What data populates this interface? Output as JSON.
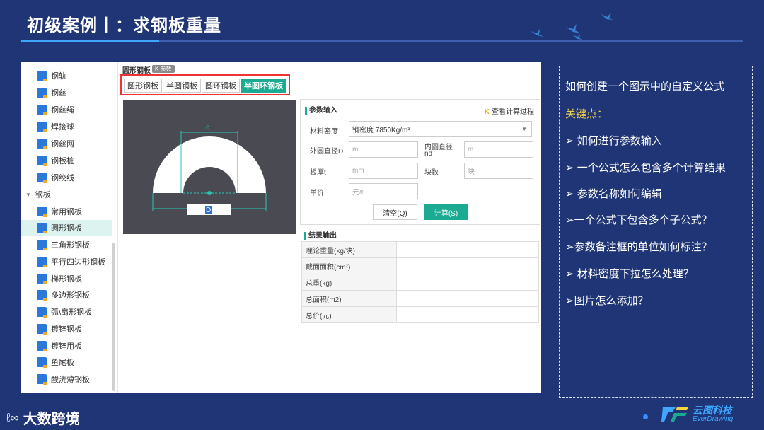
{
  "slide": {
    "title": "初级案例丨：求钢板重量"
  },
  "sidebar": {
    "items_top": [
      {
        "label": "钢轨"
      },
      {
        "label": "钢丝"
      },
      {
        "label": "钢丝绳"
      },
      {
        "label": "焊接球"
      },
      {
        "label": "钢丝网"
      },
      {
        "label": "钢板桩"
      },
      {
        "label": "钢绞线"
      }
    ],
    "group": {
      "label": "钢板"
    },
    "items": [
      {
        "label": "常用钢板"
      },
      {
        "label": "圆形钢板",
        "active": true
      },
      {
        "label": "三角形钢板"
      },
      {
        "label": "平行四边形钢板"
      },
      {
        "label": "梯形钢板"
      },
      {
        "label": "多边形钢板"
      },
      {
        "label": "弧\\扇形钢板"
      },
      {
        "label": "镀锌钢板"
      },
      {
        "label": "镀锌用板"
      },
      {
        "label": "鱼尾板"
      },
      {
        "label": "酸洗薄钢板"
      }
    ]
  },
  "section": {
    "name": "圆形钢板",
    "tag": "K 参数"
  },
  "tabs": [
    {
      "label": "圆形钢板"
    },
    {
      "label": "半圆钢板"
    },
    {
      "label": "圆环钢板"
    },
    {
      "label": "半圆环钢板",
      "selected": true
    }
  ],
  "figure": {
    "d_label": "d",
    "D_label": "D"
  },
  "params": {
    "header": "参数输入",
    "view_calc": "查看计算过程",
    "density_label": "材料密度",
    "density_value": "钢密度 7850Kg/m³",
    "outer_label": "外圆直径D",
    "outer_placeholder": "m",
    "inner_label_1": "内圆直径",
    "inner_label_2": "nd",
    "inner_placeholder": "m",
    "thickness_label": "板厚t",
    "thickness_placeholder": "mm",
    "count_label": "块数",
    "count_placeholder": "块",
    "price_label": "单价",
    "price_placeholder": "元/t",
    "clear_button": "清空(Q)",
    "calc_button": "计算(S)"
  },
  "results": {
    "header": "结果输出",
    "rows": [
      {
        "label": "理论重量(kg/块)",
        "value": ""
      },
      {
        "label": "截面面积(cm²)",
        "value": ""
      },
      {
        "label": "总重(kg)",
        "value": ""
      },
      {
        "label": "总面积(m2)",
        "value": ""
      },
      {
        "label": "总价(元)",
        "value": ""
      }
    ]
  },
  "notes": {
    "intro": "如何创建一个图示中的自定义公式",
    "key_points": "关键点：",
    "items": [
      {
        "text": "➢ 如何进行参数输入"
      },
      {
        "text": "➢ 一个公式怎么包含多个计算结果"
      },
      {
        "text": "➢ 参数名称如何编辑"
      },
      {
        "text": "➢一个公式下包含多个子公式？"
      },
      {
        "text": "➢参数备注框的单位如何标注？"
      },
      {
        "text": "➢ 材料密度下拉怎么处理？"
      },
      {
        "text": "➢图片怎么添加？"
      }
    ]
  },
  "footer": {
    "left_logo": "大数跨境",
    "left_mark": "ℓ∞",
    "right_name": "云图科技",
    "right_sub": "EverDrawing"
  }
}
